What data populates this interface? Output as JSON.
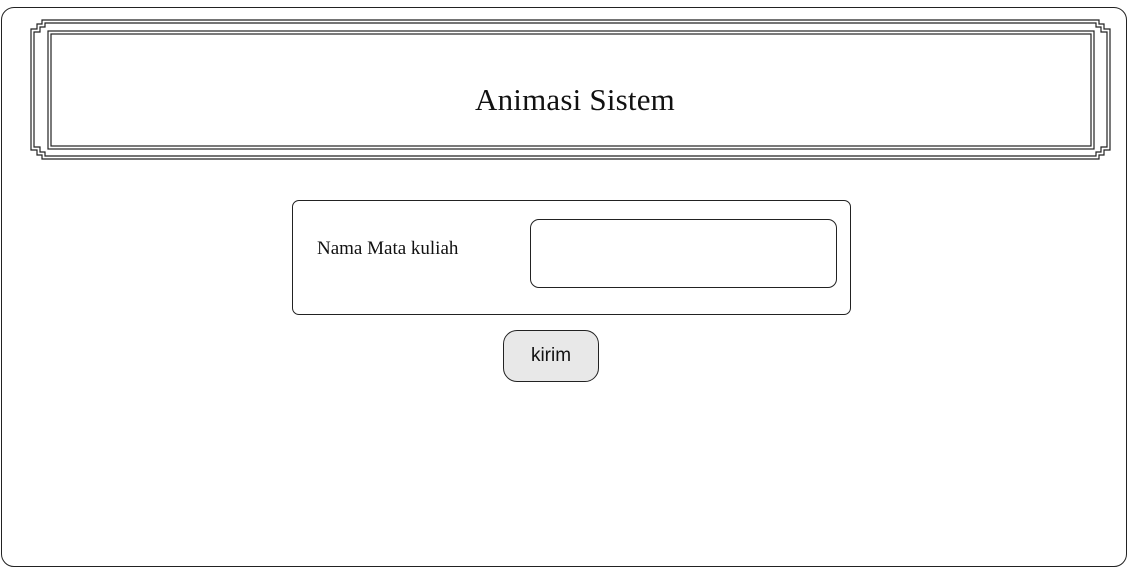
{
  "header": {
    "title": "Animasi Sistem"
  },
  "form": {
    "field_label": "Nama Mata kuliah",
    "field_value": "",
    "field_placeholder": ""
  },
  "actions": {
    "submit_label": "kirim"
  }
}
